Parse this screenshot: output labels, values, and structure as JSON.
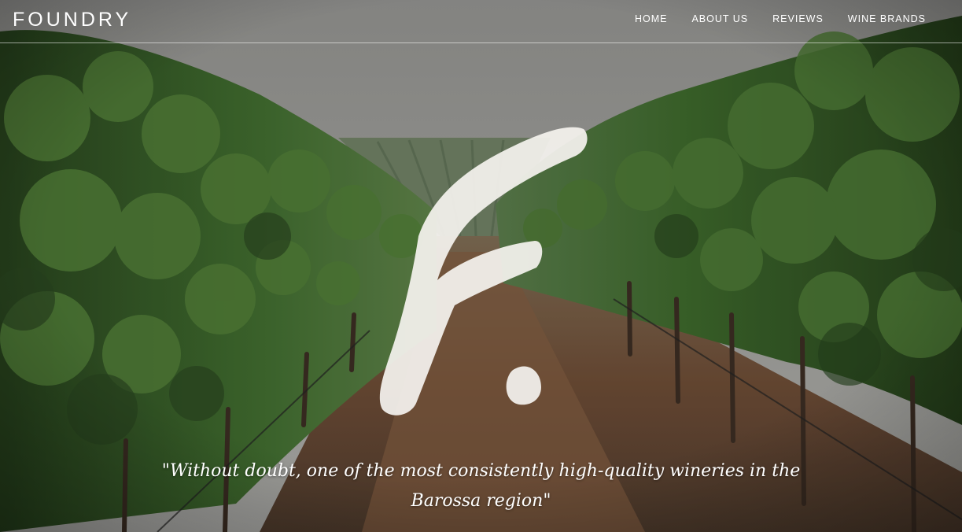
{
  "header": {
    "logo_text": "FOUNDRY",
    "nav": [
      {
        "label": "HOME"
      },
      {
        "label": "ABOUT US"
      },
      {
        "label": "REVIEWS"
      },
      {
        "label": "WINE BRANDS"
      }
    ]
  },
  "hero": {
    "background_image": "vineyard-rows",
    "brand_mark": "painted-f-monogram",
    "quote": "\"Without doubt, one of the most consistently high-quality wineries in the Barossa region\""
  },
  "colors": {
    "text": "#ffffff",
    "sky": "#9b9b98",
    "foliage": "#3d5a2e",
    "soil": "#6b4a35"
  }
}
